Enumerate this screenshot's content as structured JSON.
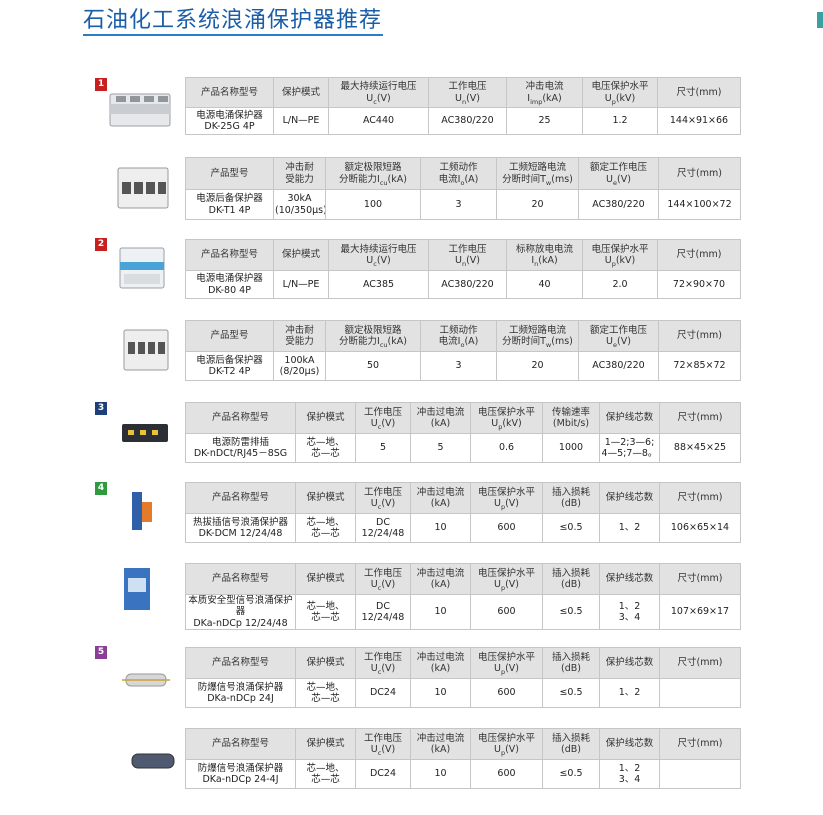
{
  "title": "石油化工系统浪涌保护器推荐",
  "colors": {
    "title": "#1a5ea8",
    "badge_red": "#c8201e",
    "badge_navy": "#1f3f7a",
    "badge_green": "#2f9a3e",
    "badge_purple": "#8a3f97",
    "header_bg": "#e2e2e2"
  },
  "groups": [
    {
      "badge": "1",
      "color": "#c8201e"
    },
    {
      "badge": "2",
      "color": "#c8201e"
    },
    {
      "badge": "3",
      "color": "#1f3f7a"
    },
    {
      "badge": "4",
      "color": "#2f9a3e"
    },
    {
      "badge": "5",
      "color": "#8a3f97"
    }
  ],
  "tables": [
    {
      "image_icon": "din-rail-spd-4p-icon",
      "headers": [
        "产品名称型号",
        "保护模式",
        "最大持续运行电压\nU<sub>c</sub>(V)",
        "工作电压\nU<sub>n</sub>(V)",
        "冲击电流\nI<sub>imp</sub>(kA)",
        "电压保护水平\nU<sub>p</sub>(kV)",
        "尺寸(mm)"
      ],
      "row": [
        "电源电涌保护器\nDK-25G 4P",
        "L/N—PE",
        "AC440",
        "AC380/220",
        "25",
        "1.2",
        "144×91×66"
      ]
    },
    {
      "image_icon": "backup-protector-4p-icon",
      "headers": [
        "产品型号",
        "冲击耐\n受能力",
        "额定极限短路\n分断能力I<sub>cu</sub>(kA)",
        "工频动作\n电流I<sub>o</sub>(A)",
        "工频短路电流\n分断时间T<sub>w</sub>(ms)",
        "额定工作电压\nU<sub>e</sub>(V)",
        "尺寸(mm)"
      ],
      "row": [
        "电源后备保护器\nDK-T1 4P",
        "30kA\n(10/350μs)",
        "100",
        "3",
        "20",
        "AC380/220",
        "144×100×72"
      ]
    },
    {
      "image_icon": "din-rail-spd-4p-blue-icon",
      "headers": [
        "产品名称型号",
        "保护模式",
        "最大持续运行电压\nU<sub>c</sub>(V)",
        "工作电压\nU<sub>n</sub>(V)",
        "标称放电电流\nI<sub>n</sub>(kA)",
        "电压保护水平\nU<sub>p</sub>(kV)",
        "尺寸(mm)"
      ],
      "row": [
        "电源电涌保护器\nDK-80 4P",
        "L/N—PE",
        "AC385",
        "AC380/220",
        "40",
        "2.0",
        "72×90×70"
      ]
    },
    {
      "image_icon": "backup-protector-4p-icon",
      "headers": [
        "产品型号",
        "冲击耐\n受能力",
        "额定极限短路\n分断能力I<sub>cu</sub>(kA)",
        "工频动作\n电流I<sub>o</sub>(A)",
        "工频短路电流\n分断时间T<sub>w</sub>(ms)",
        "额定工作电压\nU<sub>e</sub>(V)",
        "尺寸(mm)"
      ],
      "row": [
        "电源后备保护器\nDK-T2 4P",
        "100kA\n(8/20μs)",
        "50",
        "3",
        "20",
        "AC380/220",
        "72×85×72"
      ]
    },
    {
      "image_icon": "lightning-power-strip-icon",
      "headers": [
        "产品名称型号",
        "保护模式",
        "工作电压\nU<sub>c</sub>(V)",
        "冲击过电流\n(kA)",
        "电压保护水平\nU<sub>p</sub>(kV)",
        "传输速率\n(Mbit/s)",
        "保护线芯数",
        "尺寸(mm)"
      ],
      "row": [
        "电源防雷排插\nDK-nDCt/RJ45－8SG",
        "芯—地、\n芯—芯",
        "5",
        "5",
        "0.6",
        "1000",
        "1—2;3—6;\n4—5;7—8。",
        "88×45×25"
      ]
    },
    {
      "image_icon": "signal-spd-orange-icon",
      "headers": [
        "产品名称型号",
        "保护模式",
        "工作电压\nU<sub>c</sub>(V)",
        "冲击过电流\n(kA)",
        "电压保护水平\nU<sub>p</sub>(V)",
        "插入损耗\n(dB)",
        "保护线芯数",
        "尺寸(mm)"
      ],
      "row": [
        "热拔插信号浪涌保护器\nDK-DCM  12/24/48",
        "芯—地、\n芯—芯",
        "DC\n12/24/48",
        "10",
        "600",
        "≤0.5",
        "1、2",
        "106×65×14"
      ]
    },
    {
      "image_icon": "signal-spd-blue-icon",
      "headers": [
        "产品名称型号",
        "保护模式",
        "工作电压\nU<sub>c</sub>(V)",
        "冲击过电流\n(kA)",
        "电压保护水平\nU<sub>p</sub>(V)",
        "插入损耗\n(dB)",
        "保护线芯数",
        "尺寸(mm)"
      ],
      "row": [
        "本质安全型信号浪涌保护器\nDKa-nDCp  12/24/48",
        "芯—地、\n芯—芯",
        "DC\n12/24/48",
        "10",
        "600",
        "≤0.5",
        "1、2\n3、4",
        "107×69×17"
      ]
    },
    {
      "image_icon": "explosion-proof-signal-spd-icon",
      "headers": [
        "产品名称型号",
        "保护模式",
        "工作电压\nU<sub>c</sub>(V)",
        "冲击过电流\n(kA)",
        "电压保护水平\nU<sub>p</sub>(V)",
        "插入损耗\n(dB)",
        "保护线芯数",
        "尺寸(mm)"
      ],
      "row": [
        "防爆信号浪涌保护器\nDKa-nDCp  24J",
        "芯—地、\n芯—芯",
        "DC24",
        "10",
        "600",
        "≤0.5",
        "1、2",
        ""
      ]
    },
    {
      "image_icon": "explosion-proof-signal-spd-4j-icon",
      "headers": [
        "产品名称型号",
        "保护模式",
        "工作电压\nU<sub>c</sub>(V)",
        "冲击过电流\n(kA)",
        "电压保护水平\nU<sub>p</sub>(V)",
        "插入损耗\n(dB)",
        "保护线芯数",
        "尺寸(mm)"
      ],
      "row": [
        "防爆信号浪涌保护器\nDKa-nDCp  24-4J",
        "芯—地、\n芯—芯",
        "DC24",
        "10",
        "600",
        "≤0.5",
        "1、2\n3、4",
        ""
      ]
    }
  ]
}
